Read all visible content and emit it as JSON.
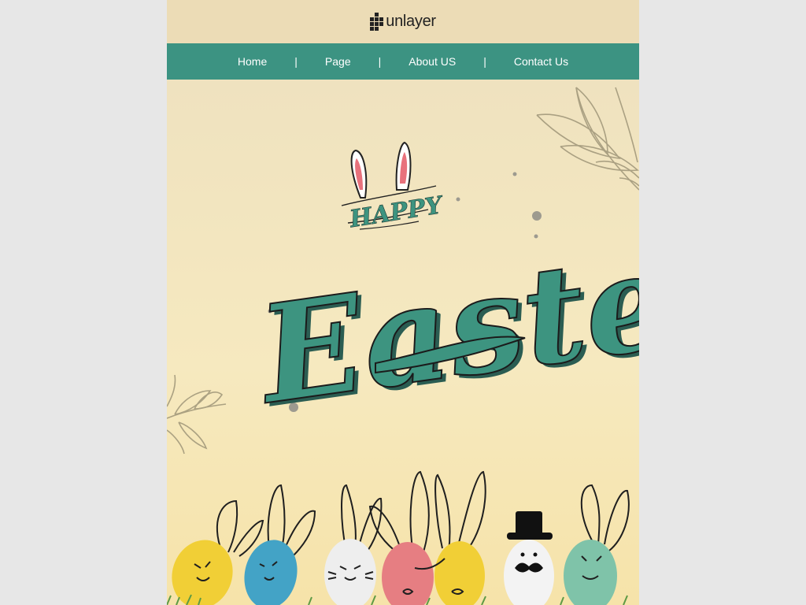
{
  "header": {
    "logo_text": "unlayer",
    "logo_icon": "unlayer-logo-icon"
  },
  "nav": {
    "items": [
      {
        "label": "Home"
      },
      {
        "label": "Page"
      },
      {
        "label": "About US"
      },
      {
        "label": "Contact Us"
      }
    ],
    "separator": "|"
  },
  "hero": {
    "kicker": "HAPPY",
    "headline": "Easter"
  },
  "colors": {
    "nav_bg": "#3c9382",
    "header_bg": "#ecdcb6",
    "accent_teal": "#3d9480",
    "page_bg": "#e7e7e7"
  }
}
